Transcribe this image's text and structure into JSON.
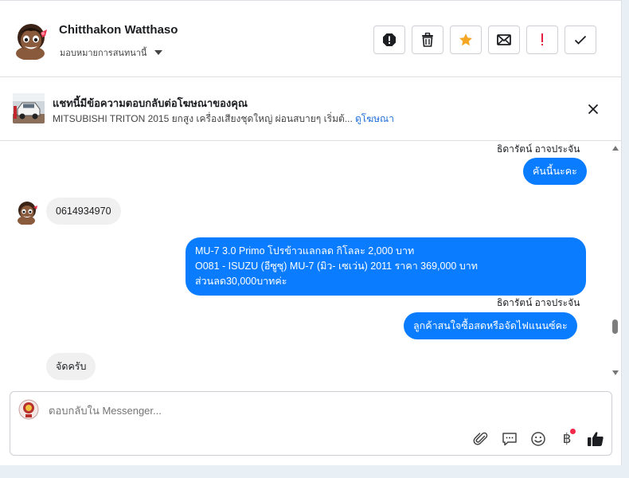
{
  "header": {
    "user_name": "Chitthakon Watthaso",
    "assign_label": "มอบหมายการสนทนานี้"
  },
  "toolbar": {
    "buttons": [
      "report-icon",
      "trash-icon",
      "star-icon",
      "envelope-icon",
      "exclamation-icon",
      "check-icon"
    ]
  },
  "ad": {
    "title": "แชทนี้มีข้อความตอบกลับต่อโฆษณาของคุณ",
    "description": "MITSUBISHI TRITON 2015 ยกสูง เครื่องเสียงชุดใหญ่ ผ่อนสบายๆ เริ่มต้...",
    "link": "ดูโฆษณา"
  },
  "messages": [
    {
      "type": "sender",
      "text": "ธิดารัตน์ อาจประจัน"
    },
    {
      "type": "out",
      "text": "คันนี้นะคะ"
    },
    {
      "type": "in",
      "text": "0614934970"
    },
    {
      "type": "out",
      "lines": [
        "MU-7 3.0 Primo โปรข้าวแลกลด กิโลละ 2,000 บาท",
        "O081 - ISUZU (อีซูซุ) MU-7 (มิว- เซเว่น) 2011  ราคา 369,000 บาท",
        "ส่วนลด30,000บาทค่ะ"
      ]
    },
    {
      "type": "sender",
      "text": "ธิดารัตน์ อาจประจัน"
    },
    {
      "type": "out",
      "text": "ลูกค้าสนใจซื้อสดหรือจัดไฟแนนซ์คะ"
    },
    {
      "type": "in",
      "text": "จัดครับ"
    }
  ],
  "composer": {
    "placeholder": "ตอบกลับใน Messenger...",
    "icons": [
      "attach-icon",
      "chat-bubble-icon",
      "emoji-icon",
      "baht-icon",
      "thumbs-up-icon"
    ],
    "baht_symbol": "฿"
  },
  "colors": {
    "outgoing_bubble": "#0a7cff",
    "incoming_bubble": "#f0f0f0",
    "link": "#216fdb",
    "star": "#f5a623",
    "exclamation": "#e41e3f"
  }
}
